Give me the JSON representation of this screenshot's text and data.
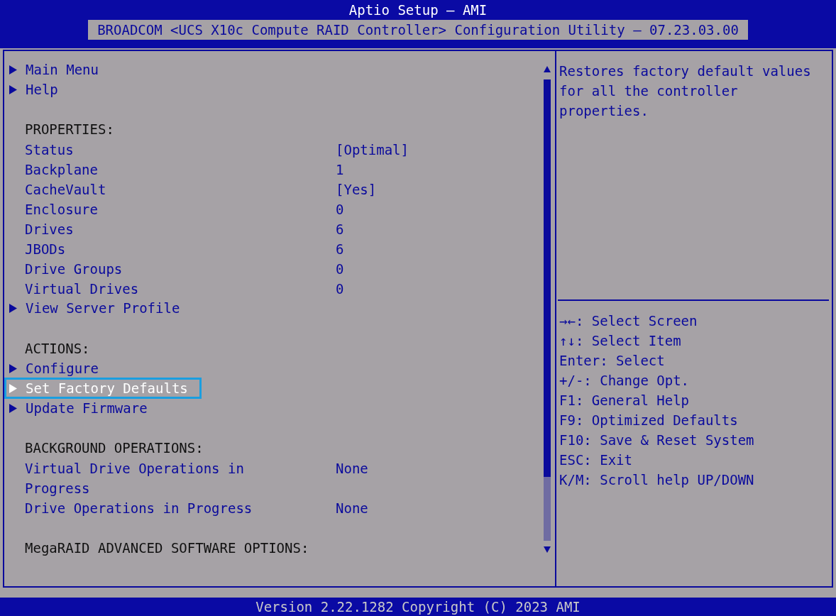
{
  "header": {
    "title": "Aptio Setup – AMI",
    "subtitle": "BROADCOM <UCS X10c Compute RAID Controller> Configuration Utility – 07.23.03.00"
  },
  "menu": [
    {
      "kind": "link",
      "label": "Main Menu",
      "selected": false
    },
    {
      "kind": "link",
      "label": "Help",
      "selected": false
    },
    {
      "kind": "blank"
    },
    {
      "kind": "heading",
      "label": "PROPERTIES:"
    },
    {
      "kind": "property",
      "label": "Status",
      "value": "[Optimal]"
    },
    {
      "kind": "property",
      "label": "Backplane",
      "value": "1"
    },
    {
      "kind": "property",
      "label": "CacheVault",
      "value": "[Yes]"
    },
    {
      "kind": "property",
      "label": "Enclosure",
      "value": "0"
    },
    {
      "kind": "property",
      "label": "Drives",
      "value": "6"
    },
    {
      "kind": "property",
      "label": "JBODs",
      "value": "6"
    },
    {
      "kind": "property",
      "label": "Drive Groups",
      "value": "0"
    },
    {
      "kind": "property",
      "label": "Virtual Drives",
      "value": "0"
    },
    {
      "kind": "link",
      "label": "View Server Profile",
      "selected": false
    },
    {
      "kind": "blank"
    },
    {
      "kind": "heading",
      "label": "ACTIONS:"
    },
    {
      "kind": "link",
      "label": "Configure",
      "selected": false
    },
    {
      "kind": "link",
      "label": "Set Factory Defaults",
      "selected": true
    },
    {
      "kind": "link",
      "label": "Update Firmware",
      "selected": false
    },
    {
      "kind": "blank"
    },
    {
      "kind": "heading",
      "label": "BACKGROUND OPERATIONS:"
    },
    {
      "kind": "property",
      "label": "Virtual Drive Operations in Progress",
      "value": "None"
    },
    {
      "kind": "property",
      "label": "Drive Operations in Progress",
      "value": "None"
    },
    {
      "kind": "blank"
    },
    {
      "kind": "heading",
      "label": "MegaRAID ADVANCED SOFTWARE OPTIONS:"
    }
  ],
  "help_text": "Restores factory default values for all the controller properties.",
  "key_help": [
    "→←: Select Screen",
    "↑↓: Select Item",
    "Enter: Select",
    "+/-: Change Opt.",
    "F1: General Help",
    "F9: Optimized Defaults",
    "F10: Save & Reset System",
    "ESC: Exit",
    "K/M: Scroll help UP/DOWN"
  ],
  "footer": "Version 2.22.1282 Copyright (C) 2023 AMI"
}
